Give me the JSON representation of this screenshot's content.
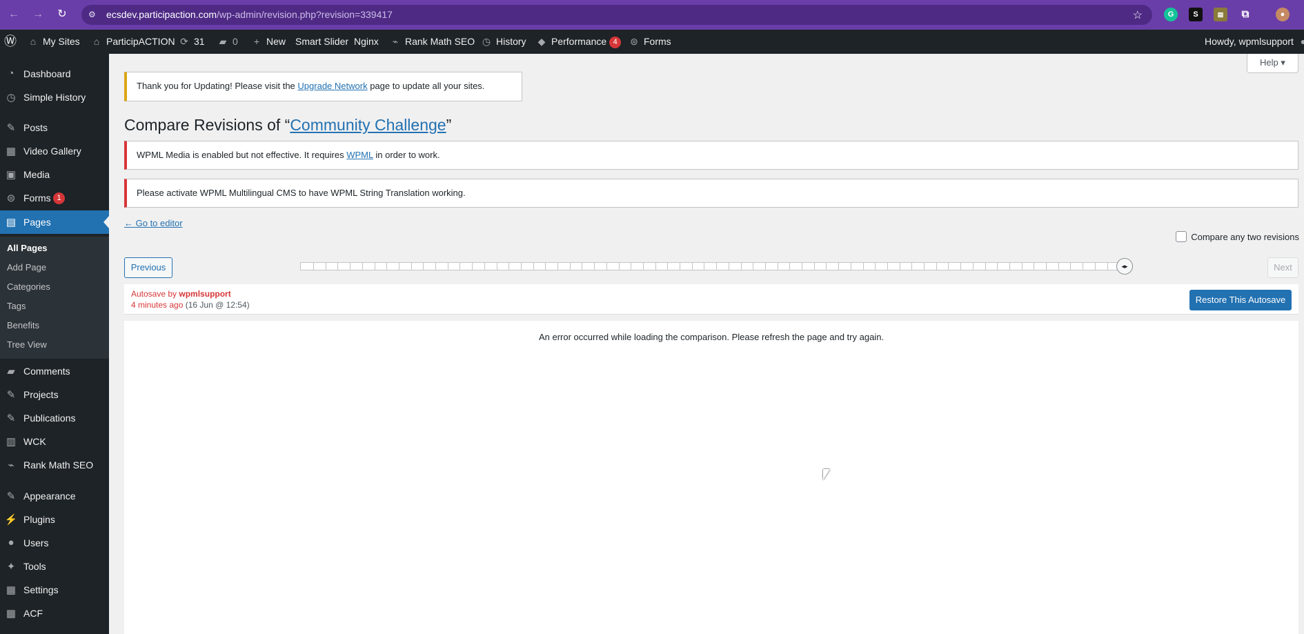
{
  "browser": {
    "url_host": "ecsdev.participaction.com",
    "url_path": "/wp-admin/revision.php?revision=339417"
  },
  "adminbar": {
    "my_sites": "My Sites",
    "site_name": "ParticipACTION",
    "updates": "31",
    "comments": "0",
    "new": "New",
    "smart_slider": "Smart Slider",
    "nginx": "Nginx",
    "rank_math": "Rank Math SEO",
    "history": "History",
    "performance": "Performance",
    "performance_count": "4",
    "forms": "Forms",
    "howdy": "Howdy, wpmlsupport"
  },
  "sidebar": {
    "items": [
      {
        "label": "Dashboard",
        "icon": "dashboard-icon"
      },
      {
        "label": "Simple History",
        "icon": "history-icon"
      },
      {
        "label": "Posts",
        "icon": "pin-icon"
      },
      {
        "label": "Video Gallery",
        "icon": "video-icon"
      },
      {
        "label": "Media",
        "icon": "media-icon"
      },
      {
        "label": "Forms",
        "icon": "forms-icon",
        "badge": "1"
      },
      {
        "label": "Pages",
        "icon": "pages-icon"
      },
      {
        "label": "Comments",
        "icon": "comments-icon"
      },
      {
        "label": "Projects",
        "icon": "pin-icon"
      },
      {
        "label": "Publications",
        "icon": "pin-icon"
      },
      {
        "label": "WCK",
        "icon": "wck-icon"
      },
      {
        "label": "Rank Math SEO",
        "icon": "chart-icon"
      },
      {
        "label": "Appearance",
        "icon": "brush-icon"
      },
      {
        "label": "Plugins",
        "icon": "plugin-icon"
      },
      {
        "label": "Users",
        "icon": "user-icon"
      },
      {
        "label": "Tools",
        "icon": "wrench-icon"
      },
      {
        "label": "Settings",
        "icon": "settings-icon"
      },
      {
        "label": "ACF",
        "icon": "grid-icon"
      }
    ],
    "submenu": [
      "All Pages",
      "Add Page",
      "Categories",
      "Tags",
      "Benefits",
      "Tree View"
    ]
  },
  "help": "Help",
  "notices": {
    "update_pre": "Thank you for Updating! Please visit the",
    "update_link": "Upgrade Network",
    "update_post": "page to update all your sites.",
    "wpml_media_pre": "WPML Media is enabled but not effective. It requires",
    "wpml_media_link": "WPML",
    "wpml_media_post": "in order to work.",
    "wpml_string": "Please activate WPML Multilingual CMS to have WPML String Translation working."
  },
  "title": {
    "prefix": "Compare Revisions of “",
    "link": "Community Challenge",
    "suffix": "”"
  },
  "go_to_editor": "← Go to editor",
  "compare_any": "Compare any two revisions",
  "previous": "Previous",
  "next": "Next",
  "autosave": {
    "label": "Autosave by",
    "author": "wpmlsupport",
    "time_ago": "4 minutes ago",
    "date": "(16 Jun @ 12:54)",
    "restore": "Restore This Autosave"
  },
  "error_message": "An error occurred while loading the comparison. Please refresh the page and try again.",
  "colors": {
    "accent": "#2271b1",
    "adminbar": "#1d2327",
    "error": "#d63638",
    "warning": "#dba617",
    "browser": "#6a3ea8"
  }
}
